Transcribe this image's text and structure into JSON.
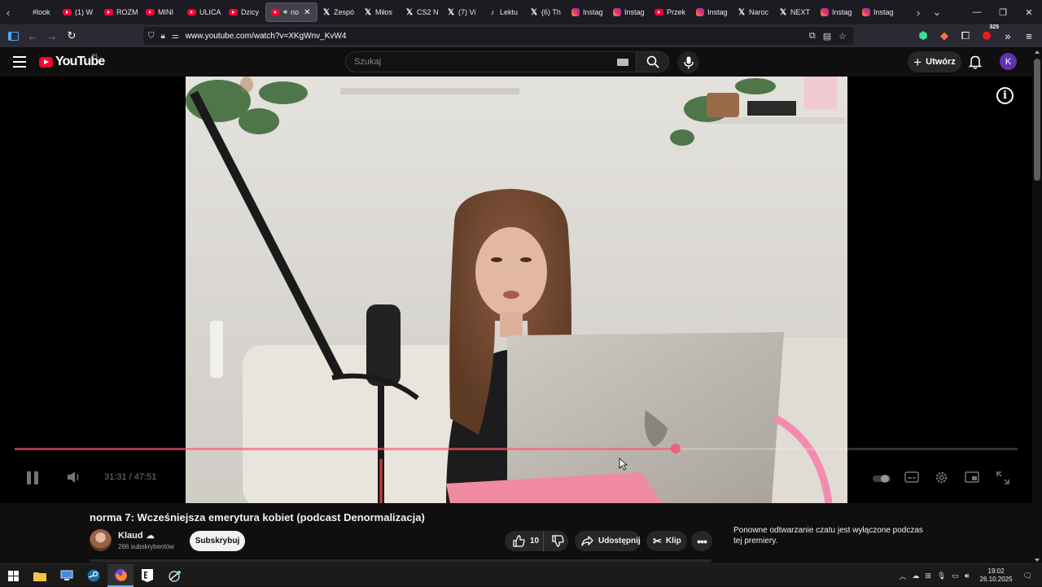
{
  "browser": {
    "tabs": [
      {
        "label": "#look",
        "icon": "none"
      },
      {
        "label": "(1) W",
        "icon": "yt"
      },
      {
        "label": "ROZM",
        "icon": "yt"
      },
      {
        "label": "MINI",
        "icon": "yt"
      },
      {
        "label": "ULICA",
        "icon": "yt"
      },
      {
        "label": "Dzicy",
        "icon": "yt"
      },
      {
        "label": "no",
        "icon": "yt",
        "active": true
      },
      {
        "label": "Zespó",
        "icon": "x"
      },
      {
        "label": "Miłos",
        "icon": "x"
      },
      {
        "label": "CS2 N",
        "icon": "x"
      },
      {
        "label": "(7) Vi",
        "icon": "x"
      },
      {
        "label": "Lektu",
        "icon": "tt"
      },
      {
        "label": "(6) Th",
        "icon": "x"
      },
      {
        "label": "Instag",
        "icon": "ig"
      },
      {
        "label": "Instag",
        "icon": "ig"
      },
      {
        "label": "Przek",
        "icon": "yt"
      },
      {
        "label": "Instag",
        "icon": "ig"
      },
      {
        "label": "Naroc",
        "icon": "x"
      },
      {
        "label": "NEXT",
        "icon": "x"
      },
      {
        "label": "Instag",
        "icon": "ig"
      },
      {
        "label": "Instag",
        "icon": "ig"
      }
    ],
    "url": "www.youtube.com/watch?v=XKgWnv_KvW4",
    "extension_badge": "325"
  },
  "youtube": {
    "logo_text": "YouTube",
    "country_code": "PL",
    "search_placeholder": "Szukaj",
    "create_label": "Utwórz",
    "account_initial": "K",
    "account_color": "#5e35b1"
  },
  "player": {
    "current_time": "31:31",
    "duration": "47:51",
    "time_display": "31:31 / 47:51",
    "progress_fraction": 0.659,
    "progress_color": "#ff3c5a"
  },
  "video": {
    "title": "norma 7: Wcześniejsza emerytura kobiet (podcast Denormalizacja)",
    "channel_name": "Klaud",
    "subscribers": "266 subskrybentów",
    "subscribe_label": "Subskrybuj",
    "likes": "10",
    "share_label": "Udostępnij",
    "clip_label": "Klip"
  },
  "chat": {
    "notice": "Ponowne odtwarzanie czatu jest wyłączone podczas tej premiery."
  },
  "taskbar": {
    "time": "19:02",
    "date": "26.10.2025"
  }
}
